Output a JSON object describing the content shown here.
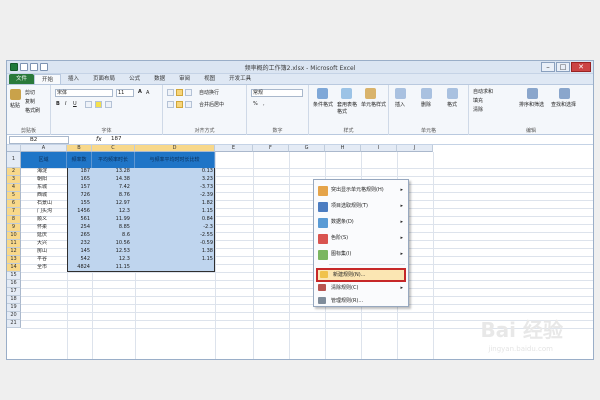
{
  "window": {
    "title": "频率概的工作簿2.xlsx - Microsoft Excel",
    "min": "–",
    "max": "□",
    "close": "✕"
  },
  "tabs": [
    "文件",
    "开始",
    "插入",
    "页面布局",
    "公式",
    "数据",
    "审阅",
    "视图",
    "开发工具"
  ],
  "ribbon": {
    "clipboard": {
      "paste": "粘贴",
      "cut": "剪切",
      "copy": "复制",
      "format": "格式刷",
      "group": "剪贴板"
    },
    "font": {
      "name": "宋体",
      "size": "11",
      "bold": "B",
      "italic": "I",
      "underline": "U",
      "grow": "A",
      "shrink": "A",
      "group": "字体"
    },
    "alignment": {
      "wrap": "自动换行",
      "merge": "合并后居中",
      "group": "对齐方式"
    },
    "number": {
      "format": "常规",
      "percent": "%",
      "comma": ",",
      "group": "数字"
    },
    "styles": {
      "cf": "条件格式",
      "table": "套用表格格式",
      "cellstyle": "单元格样式",
      "group": "样式"
    },
    "cells": {
      "insert": "插入",
      "delete": "删除",
      "format": "格式",
      "group": "单元格"
    },
    "editing": {
      "autosum": "自动求和",
      "fill": "填充",
      "clear": "清除",
      "sort": "排序和筛选",
      "find": "查找和选择",
      "group": "编辑"
    }
  },
  "formula_bar": {
    "name": "B2",
    "fx": "fx",
    "value": "187"
  },
  "columns": [
    "A",
    "B",
    "C",
    "D",
    "E",
    "F",
    "G",
    "H",
    "I",
    "J"
  ],
  "rows": [
    "1",
    "2",
    "3",
    "4",
    "5",
    "6",
    "7",
    "8",
    "9",
    "10",
    "11",
    "12",
    "13",
    "14",
    "15",
    "16",
    "17",
    "18",
    "19",
    "20",
    "21"
  ],
  "table": {
    "headers": [
      "区域",
      "频率数",
      "平均频率时长",
      "与频率平均时时长比较"
    ],
    "rows": [
      [
        "海淀",
        "187",
        "13.28",
        "0.13"
      ],
      [
        "朝阳",
        "165",
        "14.38",
        "3.23"
      ],
      [
        "东城",
        "157",
        "7.42",
        "-3.73"
      ],
      [
        "西城",
        "726",
        "8.76",
        "-2.39"
      ],
      [
        "石景山",
        "155",
        "12.97",
        "1.82"
      ],
      [
        "门头沟",
        "1456",
        "12.3",
        "1.15"
      ],
      [
        "顺义",
        "561",
        "11.99",
        "0.84"
      ],
      [
        "怀柔",
        "254",
        "8.85",
        "-2.3"
      ],
      [
        "延庆",
        "265",
        "8.6",
        "-2.55"
      ],
      [
        "大兴",
        "232",
        "10.56",
        "-0.59"
      ],
      [
        "房山",
        "145",
        "12.53",
        "1.38"
      ],
      [
        "平谷",
        "542",
        "12.3",
        "1.15"
      ],
      [
        "全市",
        "4824",
        "11.15",
        ""
      ]
    ]
  },
  "menu": {
    "items": [
      {
        "label": "突出显示单元格规则(H)",
        "icon": "highlight-rules-icon",
        "arrow": "▸"
      },
      {
        "label": "项目选取规则(T)",
        "icon": "top-bottom-rules-icon",
        "arrow": "▸"
      },
      {
        "label": "数据条(D)",
        "icon": "data-bars-icon",
        "arrow": "▸"
      },
      {
        "label": "色阶(S)",
        "icon": "color-scales-icon",
        "arrow": "▸"
      },
      {
        "label": "图标集(I)",
        "icon": "icon-sets-icon",
        "arrow": "▸"
      },
      {
        "label": "新建规则(N)...",
        "icon": "new-rule-icon",
        "arrow": ""
      },
      {
        "label": "清除规则(C)",
        "icon": "clear-rules-icon",
        "arrow": "▸"
      },
      {
        "label": "管理规则(R)...",
        "icon": "manage-rules-icon",
        "arrow": ""
      }
    ]
  },
  "watermark": {
    "main": "Bai 经验",
    "sub": "jingyan.baidu.com"
  }
}
